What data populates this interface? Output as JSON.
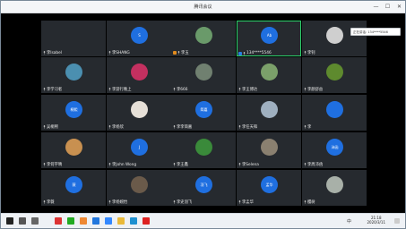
{
  "window": {
    "title": "腾讯会议",
    "min_label": "—",
    "max_label": "☐",
    "close_label": "✕"
  },
  "notice": {
    "text": "正在讲话: 134****5546"
  },
  "tiles": [
    {
      "name": "李Isabel",
      "avatar_text": "",
      "has_avatar": false,
      "col": 0,
      "row": 0,
      "blank": true
    },
    {
      "name": "李SHANG",
      "avatar_text": "S",
      "has_avatar": true,
      "image": false,
      "col": 1,
      "row": 0
    },
    {
      "name": "李玉",
      "avatar_text": "",
      "has_avatar": true,
      "image": true,
      "img_color": "#6a9a6a",
      "col": 2,
      "row": 0,
      "badge": "#e08a1e"
    },
    {
      "name": "134****5546",
      "avatar_text": "Ab",
      "has_avatar": true,
      "image": false,
      "col": 3,
      "row": 0,
      "badge": "#2a7fe0",
      "speaking": true
    },
    {
      "name": "李钊",
      "avatar_text": "",
      "has_avatar": true,
      "image": true,
      "img_color": "#cfcfcf",
      "col": 4,
      "row": 0
    },
    {
      "name": "李学习者",
      "avatar_text": "",
      "has_avatar": true,
      "image": true,
      "img_color": "#4b8fb0",
      "col": 0,
      "row": 1
    },
    {
      "name": "李游行晚上",
      "avatar_text": "",
      "has_avatar": true,
      "image": true,
      "img_color": "#c43060",
      "col": 1,
      "row": 1
    },
    {
      "name": "李666",
      "avatar_text": "",
      "has_avatar": true,
      "image": true,
      "img_color": "#708070",
      "col": 2,
      "row": 1
    },
    {
      "name": "李王博达",
      "avatar_text": "",
      "has_avatar": true,
      "image": true,
      "img_color": "#7ba06a",
      "col": 3,
      "row": 1
    },
    {
      "name": "李颜舒益",
      "avatar_text": "",
      "has_avatar": true,
      "image": true,
      "img_color": "#5e8a2e",
      "col": 4,
      "row": 1
    },
    {
      "name": "吴桐熙",
      "avatar_text": "桐熙",
      "has_avatar": true,
      "image": false,
      "col": 0,
      "row": 2
    },
    {
      "name": "李杨欣",
      "avatar_text": "",
      "has_avatar": true,
      "image": true,
      "img_color": "#e6e0d8",
      "col": 1,
      "row": 2
    },
    {
      "name": "李李简嘉",
      "avatar_text": "简嘉",
      "has_avatar": true,
      "image": false,
      "col": 2,
      "row": 2
    },
    {
      "name": "李任天和",
      "avatar_text": "",
      "has_avatar": true,
      "image": true,
      "img_color": "#9fb0c0",
      "col": 3,
      "row": 2
    },
    {
      "name": "李",
      "avatar_text": "",
      "has_avatar": true,
      "image": false,
      "col": 4,
      "row": 2
    },
    {
      "name": "李何宇晴",
      "avatar_text": "",
      "has_avatar": true,
      "image": true,
      "img_color": "#c89050",
      "col": 0,
      "row": 3
    },
    {
      "name": "李John Wong",
      "avatar_text": "J",
      "has_avatar": true,
      "image": false,
      "col": 1,
      "row": 3
    },
    {
      "name": "李王鑫",
      "avatar_text": "",
      "has_avatar": true,
      "image": true,
      "img_color": "#3a8a3a",
      "col": 2,
      "row": 3
    },
    {
      "name": "李Selena",
      "avatar_text": "",
      "has_avatar": true,
      "image": true,
      "img_color": "#8a8070",
      "col": 3,
      "row": 3
    },
    {
      "name": "李周沛函",
      "avatar_text": "沛函",
      "has_avatar": true,
      "image": false,
      "col": 4,
      "row": 3
    },
    {
      "name": "李薇",
      "avatar_text": "薇",
      "has_avatar": true,
      "image": false,
      "col": 0,
      "row": 4
    },
    {
      "name": "李杨婉怡",
      "avatar_text": "",
      "has_avatar": true,
      "image": true,
      "img_color": "#6a5a4a",
      "col": 1,
      "row": 4
    },
    {
      "name": "李史羽飞",
      "avatar_text": "羽飞",
      "has_avatar": true,
      "image": false,
      "col": 2,
      "row": 4
    },
    {
      "name": "李孟华",
      "avatar_text": "孟华",
      "has_avatar": true,
      "image": false,
      "col": 3,
      "row": 4
    },
    {
      "name": "樱树",
      "avatar_text": "",
      "has_avatar": true,
      "image": true,
      "img_color": "#a8b0a8",
      "col": 4,
      "row": 4
    }
  ],
  "taskbar": {
    "time": "21:18",
    "date": "2020/3/11",
    "lang": "中",
    "icons": [
      {
        "name": "start-icon",
        "color": "#222"
      },
      {
        "name": "search-icon",
        "color": "#555"
      },
      {
        "name": "taskview-icon",
        "color": "#666"
      },
      {
        "name": "app-red-icon",
        "color": "#d33"
      },
      {
        "name": "app-green-icon",
        "color": "#2a2"
      },
      {
        "name": "app-orange-icon",
        "color": "#e83"
      },
      {
        "name": "app-blue-icon",
        "color": "#27d"
      },
      {
        "name": "app-meeting-icon",
        "color": "#38f"
      },
      {
        "name": "app-folder-icon",
        "color": "#e9b93a"
      },
      {
        "name": "app-ie-icon",
        "color": "#1e90d0"
      },
      {
        "name": "app-wps-icon",
        "color": "#d22"
      }
    ]
  }
}
